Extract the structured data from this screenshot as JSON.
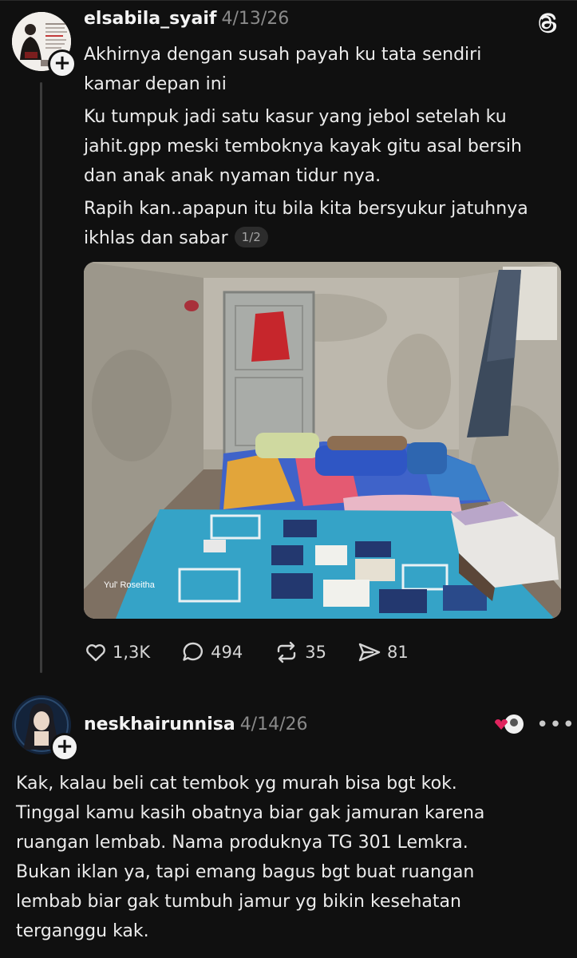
{
  "post": {
    "username": "elsabila_syaif",
    "date": "4/13/26",
    "lines": [
      "Akhirnya dengan susah payah ku tata sendiri",
      "kamar depan ini",
      "Ku tumpuk jadi satu kasur yang jebol setelah ku",
      "jahit.gpp meski temboknya kayak gitu  asal bersih",
      "dan anak anak nyaman tidur nya.",
      "Rapih kan..apapun itu bila kita bersyukur jatuhnya",
      "ikhlas dan sabar"
    ],
    "pager": "1/2",
    "photo_watermark": "Yul' Roseitha",
    "stats": {
      "likes": "1,3K",
      "replies": "494",
      "reposts": "35",
      "shares": "81"
    },
    "icons": {
      "like": "heart-icon",
      "reply": "comment-icon",
      "repost": "repost-icon",
      "share": "send-icon",
      "app": "threads-logo-icon",
      "follow": "plus-icon"
    }
  },
  "reply": {
    "username": "neskhairunnisa",
    "date": "4/14/26",
    "more": "•••",
    "lines": [
      "Kak, kalau beli cat tembok yg murah bisa bgt kok.",
      "Tinggal kamu kasih obatnya biar gak jamuran karena",
      "ruangan lembab. Nama produknya TG 301 Lemkra.",
      "Bukan iklan ya, tapi emang bagus bgt buat ruangan",
      "lembab biar gak tumbuh jamur yg bikin kesehatan",
      "terganggu kak."
    ]
  },
  "colors": {
    "background": "#101010",
    "text": "#f3f3f3",
    "muted": "#8a8a8a",
    "heart_red": "#e0245e"
  }
}
